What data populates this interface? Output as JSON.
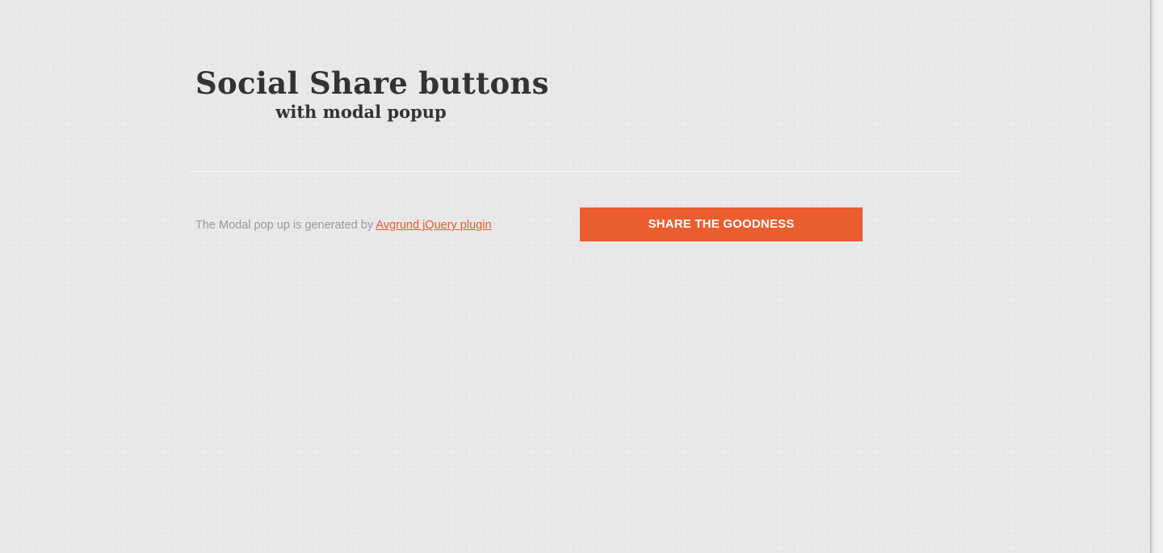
{
  "header": {
    "title": "Social Share buttons",
    "subtitle": "with modal popup"
  },
  "content": {
    "note_text": "The Modal pop up is generated by ",
    "note_link_label": "Avgrund jQuery plugin",
    "share_button_label": "SHARE THE GOODNESS"
  },
  "colors": {
    "accent": "#eb5d2f",
    "link": "#e95b2e",
    "heading": "#333333",
    "muted_text": "#999999",
    "background": "#e8e8e8"
  }
}
